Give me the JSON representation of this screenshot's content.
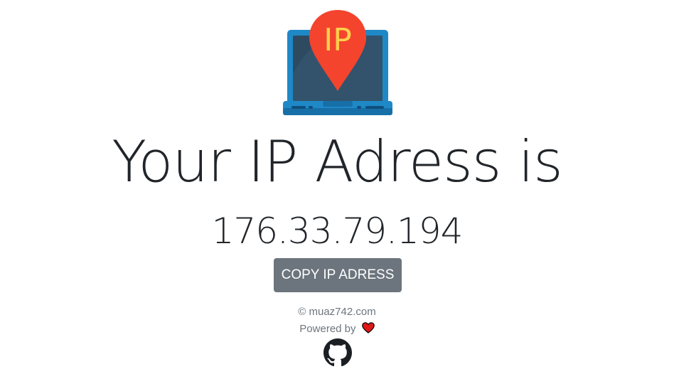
{
  "header": {
    "logo_text": "IP"
  },
  "main": {
    "headline": "Your IP Adress is",
    "ip_address": "176.33.79.194",
    "copy_button_label": "COPY IP ADRESS"
  },
  "footer": {
    "copyright": "© muaz742.com",
    "powered_by": "Powered by",
    "powered_icon": "heart-icon",
    "link_icon": "github-icon"
  },
  "colors": {
    "button_bg": "#6c757d",
    "pin_red": "#f4442e",
    "pin_text": "#ffd04c",
    "laptop_blue": "#1f88c7",
    "screen_dark": "#2e4a60",
    "heart": "#e01818"
  }
}
